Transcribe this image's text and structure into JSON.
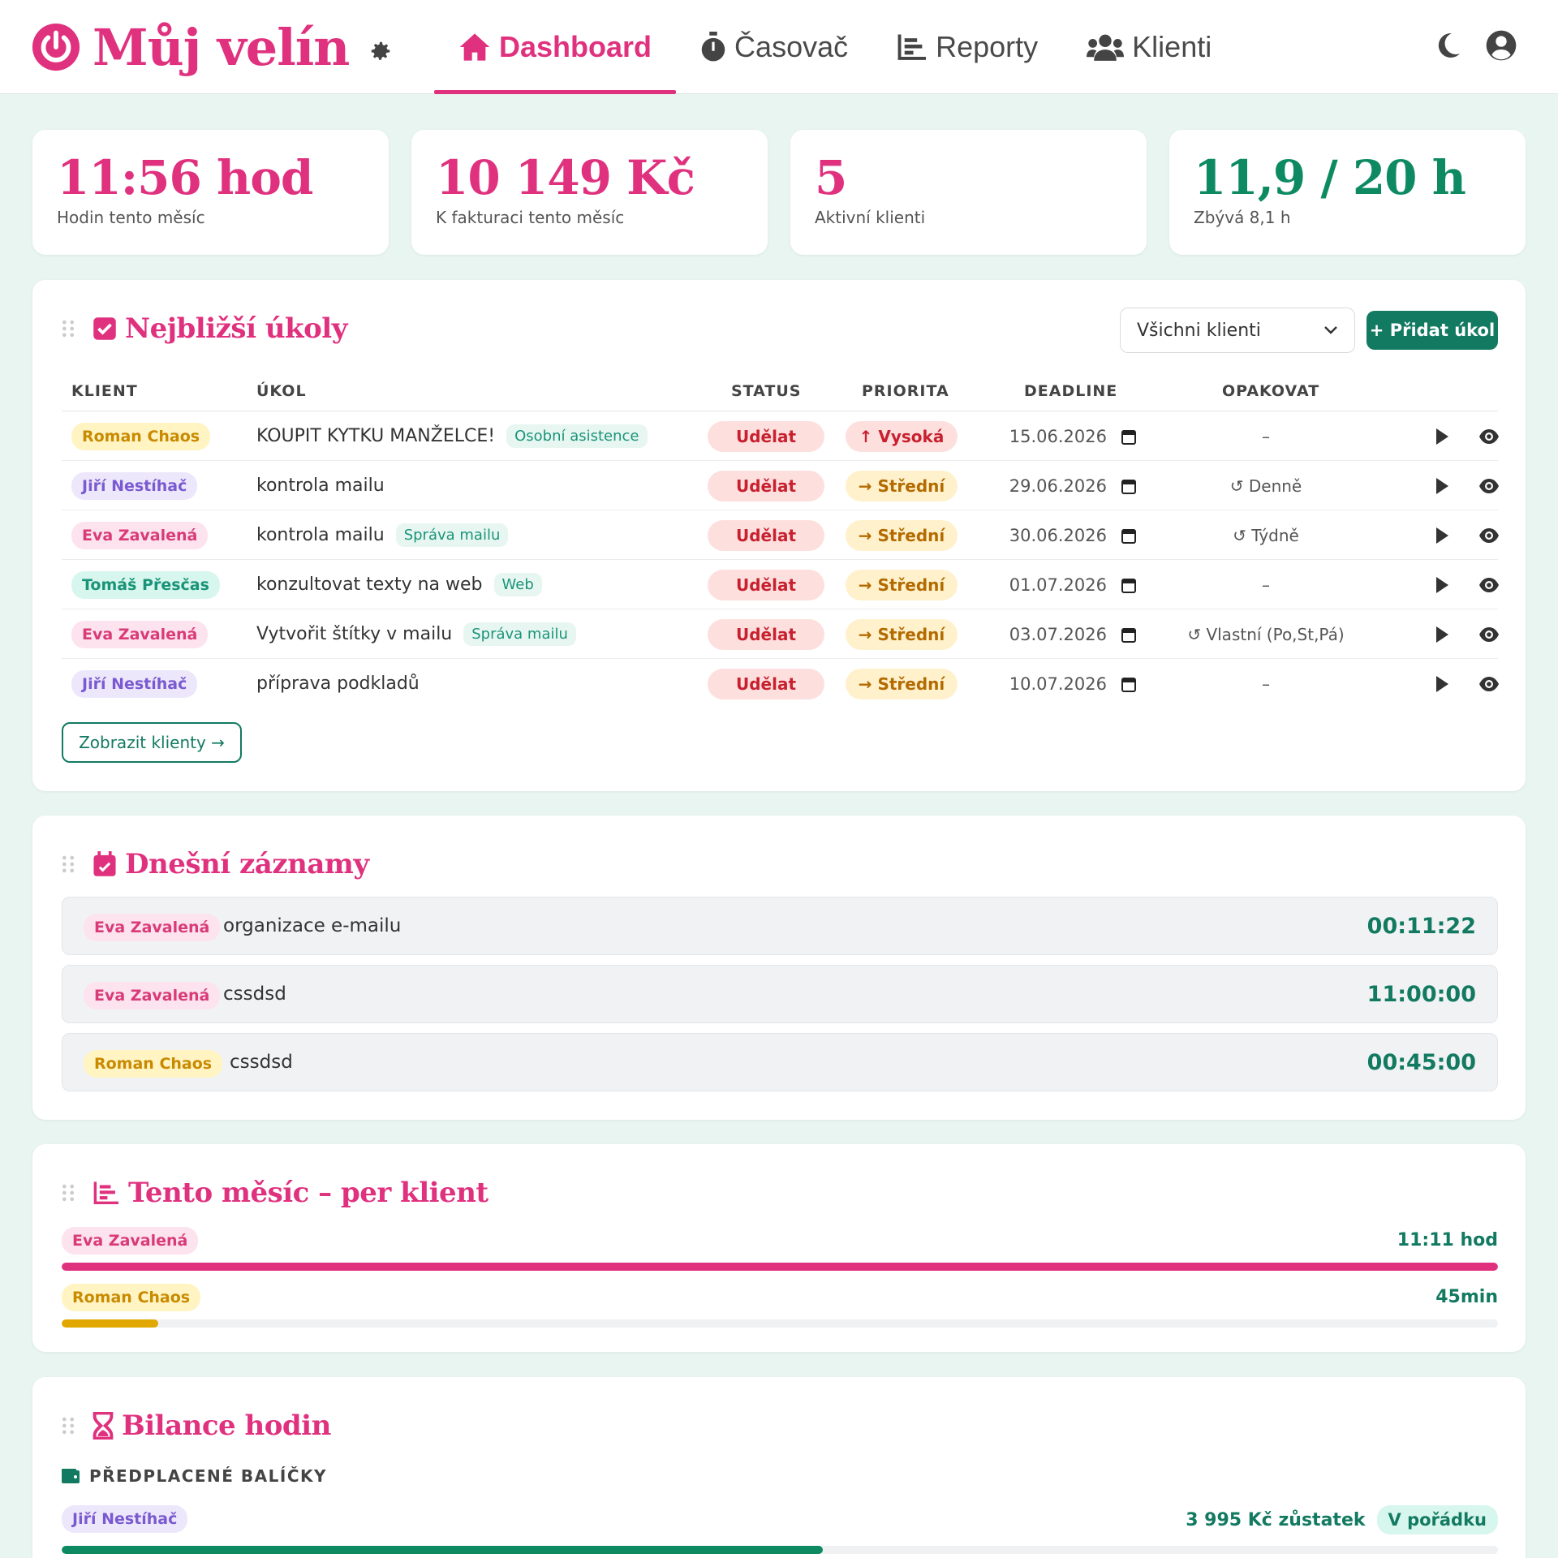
{
  "header": {
    "title": "Můj velín",
    "nav": [
      {
        "label": "Dashboard",
        "icon": "home-icon"
      },
      {
        "label": "Časovač",
        "icon": "stopwatch-icon"
      },
      {
        "label": "Reporty",
        "icon": "chart-icon"
      },
      {
        "label": "Klienti",
        "icon": "users-icon"
      }
    ]
  },
  "stats": [
    {
      "value": "11:56 hod",
      "label": "Hodin tento měsíc"
    },
    {
      "value": "10 149 Kč",
      "label": "K fakturaci tento měsíc"
    },
    {
      "value": "5",
      "label": "Aktivní klienti"
    },
    {
      "value": "11,9 / 20 h",
      "label": "Zbývá 8,1 h"
    }
  ],
  "tasks": {
    "title": "Nejbližší úkoly",
    "filter_value": "Všichni klienti",
    "add_label": "+ Přidat úkol",
    "columns": {
      "client": "KLIENT",
      "task": "ÚKOL",
      "status": "STATUS",
      "priority": "PRIORITA",
      "deadline": "DEADLINE",
      "repeat": "OPAKOVAT"
    },
    "rows": [
      {
        "client": "Roman Chaos",
        "color": "yellow",
        "task": "KOUPIT KYTKU MANŽELCE!",
        "tag": "Osobní asistence",
        "status": "Udělat",
        "priority": "↑ Vysoká",
        "prio": "high",
        "deadline": "15.06.2026",
        "repeat": "–"
      },
      {
        "client": "Jiří Nestíhač",
        "color": "purple",
        "task": "kontrola mailu",
        "tag": "",
        "status": "Udělat",
        "priority": "→ Střední",
        "prio": "mid",
        "deadline": "29.06.2026",
        "repeat": "↺ Denně"
      },
      {
        "client": "Eva Zavalená",
        "color": "pink",
        "task": "kontrola mailu",
        "tag": "Správa mailu",
        "status": "Udělat",
        "priority": "→ Střední",
        "prio": "mid",
        "deadline": "30.06.2026",
        "repeat": "↺ Týdně"
      },
      {
        "client": "Tomáš Přesčas",
        "color": "teal",
        "task": "konzultovat texty na web",
        "tag": "Web",
        "status": "Udělat",
        "priority": "→ Střední",
        "prio": "mid",
        "deadline": "01.07.2026",
        "repeat": "–"
      },
      {
        "client": "Eva Zavalená",
        "color": "pink",
        "task": "Vytvořit štítky v mailu",
        "tag": "Správa mailu",
        "status": "Udělat",
        "priority": "→ Střední",
        "prio": "mid",
        "deadline": "03.07.2026",
        "repeat": "↺ Vlastní (Po,St,Pá)"
      },
      {
        "client": "Jiří Nestíhač",
        "color": "purple",
        "task": "příprava podkladů",
        "tag": "",
        "status": "Udělat",
        "priority": "→ Střední",
        "prio": "mid",
        "deadline": "10.07.2026",
        "repeat": "–"
      }
    ],
    "show_clients_label": "Zobrazit klienty →"
  },
  "today": {
    "title": "Dnešní záznamy",
    "entries": [
      {
        "client": "Eva Zavalená",
        "color": "pink",
        "text": "organizace e-mailu",
        "time": "00:11:22"
      },
      {
        "client": "Eva Zavalená",
        "color": "pink",
        "text": "cssdsd",
        "time": "11:00:00"
      },
      {
        "client": "Roman Chaos",
        "color": "yellow",
        "text": "cssdsd",
        "time": "00:45:00"
      }
    ]
  },
  "month": {
    "title": "Tento měsíc – per klient",
    "rows": [
      {
        "client": "Eva Zavalená",
        "color": "pink",
        "value": "11:11 hod",
        "fraction": 1.0,
        "bar_color": "#e0317f"
      },
      {
        "client": "Roman Chaos",
        "color": "yellow",
        "value": "45min",
        "fraction": 0.067,
        "bar_color": "#e0a800"
      }
    ]
  },
  "balance": {
    "title": "Bilance hodin",
    "subtitle": "PŘEDPLACENÉ BALÍČKY",
    "rows": [
      {
        "client": "Jiří Nestíhač",
        "color": "purple",
        "amount": "3 995 Kč zůstatek",
        "status": "V pořádku",
        "fraction": 0.53,
        "bar_color": "#0e8a63"
      }
    ]
  }
}
